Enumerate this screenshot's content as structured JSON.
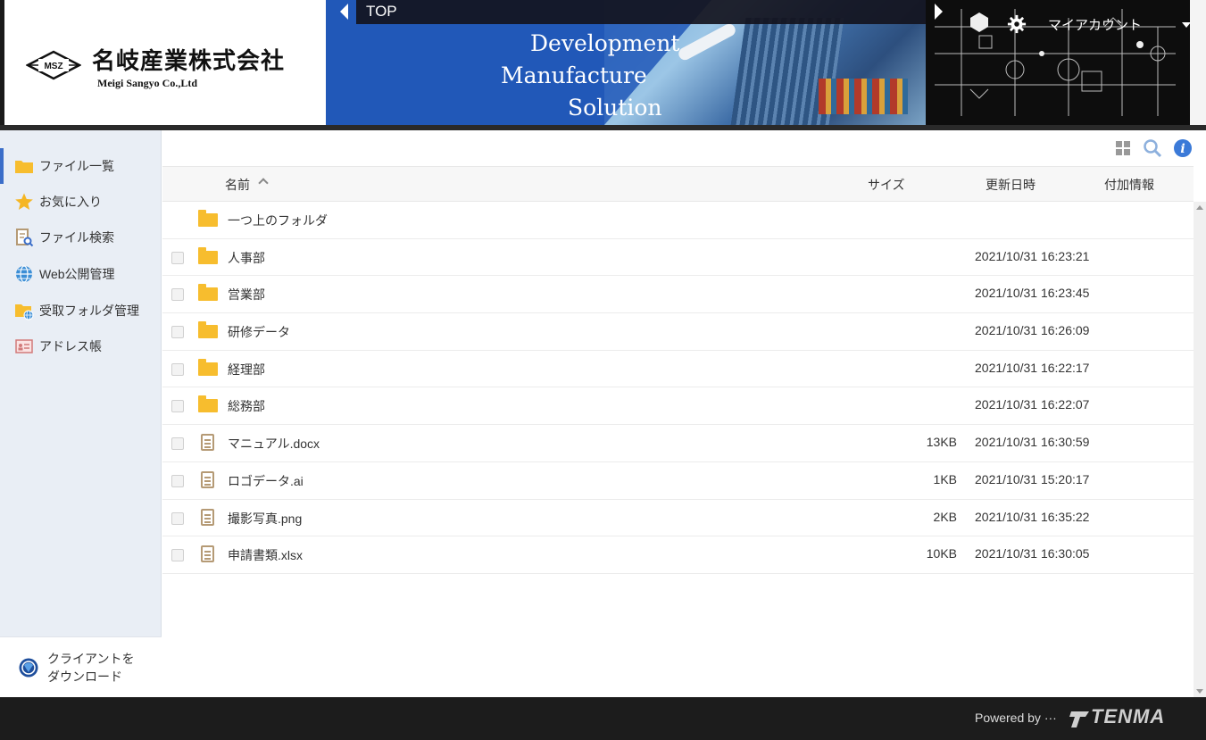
{
  "header": {
    "company_name": "名岐産業株式会社",
    "company_sub": "Meigi Sangyo Co.,Ltd",
    "logo_mark_text": "MSZ",
    "banner_lines": [
      "Development",
      "Manufacture",
      "Solution"
    ],
    "nav_label": "TOP",
    "account_label": "マイアカウント"
  },
  "sidebar": {
    "items": [
      {
        "label": "ファイル一覧",
        "icon": "folder-icon",
        "active": true
      },
      {
        "label": "お気に入り",
        "icon": "star-icon"
      },
      {
        "label": "ファイル検索",
        "icon": "file-search-icon"
      },
      {
        "label": "Web公開管理",
        "icon": "globe-icon"
      },
      {
        "label": "受取フォルダ管理",
        "icon": "receive-folder-icon"
      },
      {
        "label": "アドレス帳",
        "icon": "address-book-icon"
      }
    ],
    "download_line1": "クライアントを",
    "download_line2": "ダウンロード"
  },
  "toolbar": {
    "icons": [
      "grid-view-icon",
      "search-icon",
      "info-icon"
    ]
  },
  "table": {
    "columns": {
      "name": "名前",
      "size": "サイズ",
      "modified": "更新日時",
      "extra": "付加情報"
    },
    "parent_folder": "一つ上のフォルダ",
    "rows": [
      {
        "type": "folder",
        "name": "人事部",
        "size": "",
        "date": "2021/10/31 16:23:21"
      },
      {
        "type": "folder",
        "name": "営業部",
        "size": "",
        "date": "2021/10/31 16:23:45"
      },
      {
        "type": "folder",
        "name": "研修データ",
        "size": "",
        "date": "2021/10/31 16:26:09"
      },
      {
        "type": "folder",
        "name": "経理部",
        "size": "",
        "date": "2021/10/31 16:22:17"
      },
      {
        "type": "folder",
        "name": "総務部",
        "size": "",
        "date": "2021/10/31 16:22:07"
      },
      {
        "type": "file",
        "name": "マニュアル.docx",
        "size": "13KB",
        "date": "2021/10/31 16:30:59"
      },
      {
        "type": "file",
        "name": "ロゴデータ.ai",
        "size": "1KB",
        "date": "2021/10/31 15:20:17"
      },
      {
        "type": "file",
        "name": "撮影写真.png",
        "size": "2KB",
        "date": "2021/10/31 16:35:22"
      },
      {
        "type": "file",
        "name": "申請書類.xlsx",
        "size": "10KB",
        "date": "2021/10/31 16:30:05"
      }
    ]
  },
  "footer": {
    "powered_by": "Powered by ···",
    "brand": "TENMA"
  },
  "colors": {
    "accent": "#3b6ec9",
    "folder": "#f7bd2e",
    "banner_blue": "#2158b8",
    "sidebar_bg": "#e9eef5",
    "footer_bg": "#1c1c1c"
  }
}
